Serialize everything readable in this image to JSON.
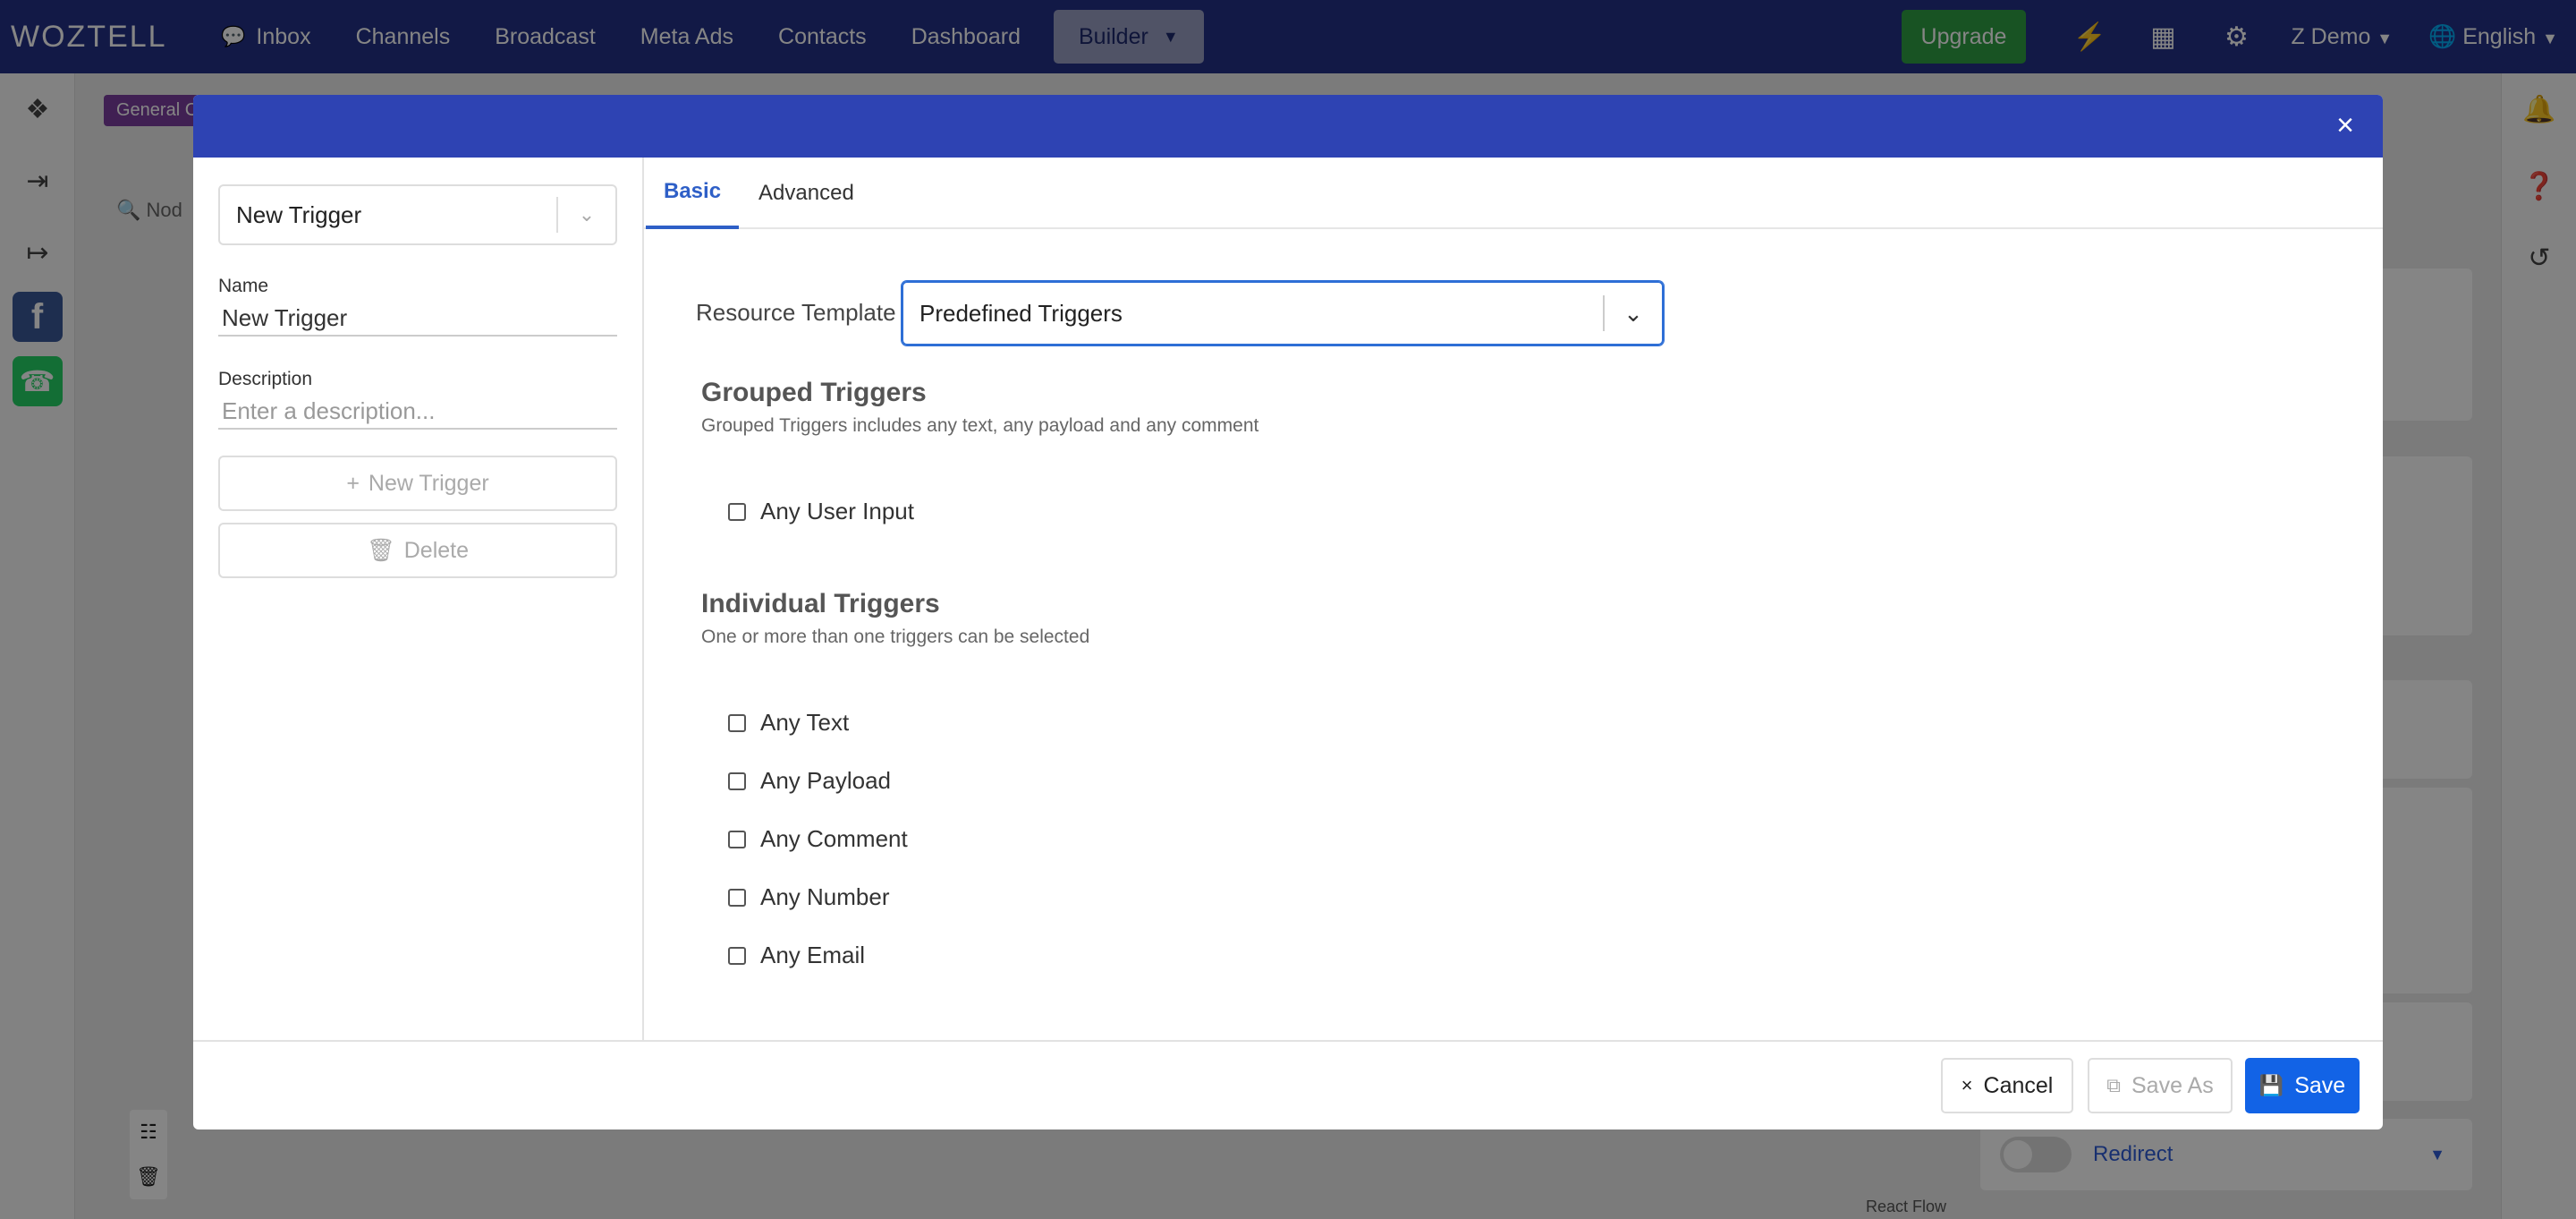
{
  "nav": {
    "logo": "WOZTELL",
    "items": [
      {
        "label": "Inbox",
        "icon": "chat-icon"
      },
      {
        "label": "Channels"
      },
      {
        "label": "Broadcast"
      },
      {
        "label": "Meta Ads"
      },
      {
        "label": "Contacts"
      },
      {
        "label": "Dashboard"
      }
    ],
    "builder_label": "Builder",
    "upgrade_label": "Upgrade",
    "user_label": "Z Demo",
    "language_label": "English"
  },
  "background": {
    "chip_label": "General C",
    "search_placeholder": "Nod",
    "redirect_label": "Redirect",
    "react_flow_label": "React Flow"
  },
  "modal": {
    "trigger_select_value": "New Trigger",
    "name_label": "Name",
    "name_value": "New Trigger",
    "description_label": "Description",
    "description_placeholder": "Enter a description...",
    "new_trigger_button": "New Trigger",
    "delete_button": "Delete",
    "tabs": [
      {
        "label": "Basic",
        "active": true
      },
      {
        "label": "Advanced",
        "active": false
      }
    ],
    "resource_template_label": "Resource Template",
    "resource_template_value": "Predefined Triggers",
    "grouped": {
      "title": "Grouped Triggers",
      "description": "Grouped Triggers includes any text, any payload and any comment",
      "options": [
        "Any User Input"
      ]
    },
    "individual": {
      "title": "Individual Triggers",
      "description": "One or more than one triggers can be selected",
      "options": [
        "Any Text",
        "Any Payload",
        "Any Comment",
        "Any Number",
        "Any Email"
      ]
    },
    "footer": {
      "cancel": "Cancel",
      "save_as": "Save As",
      "save": "Save"
    }
  },
  "colors": {
    "nav_bg": "#233086",
    "modal_header": "#2e43b3",
    "primary": "#1263e6",
    "upgrade": "#2ea043"
  }
}
